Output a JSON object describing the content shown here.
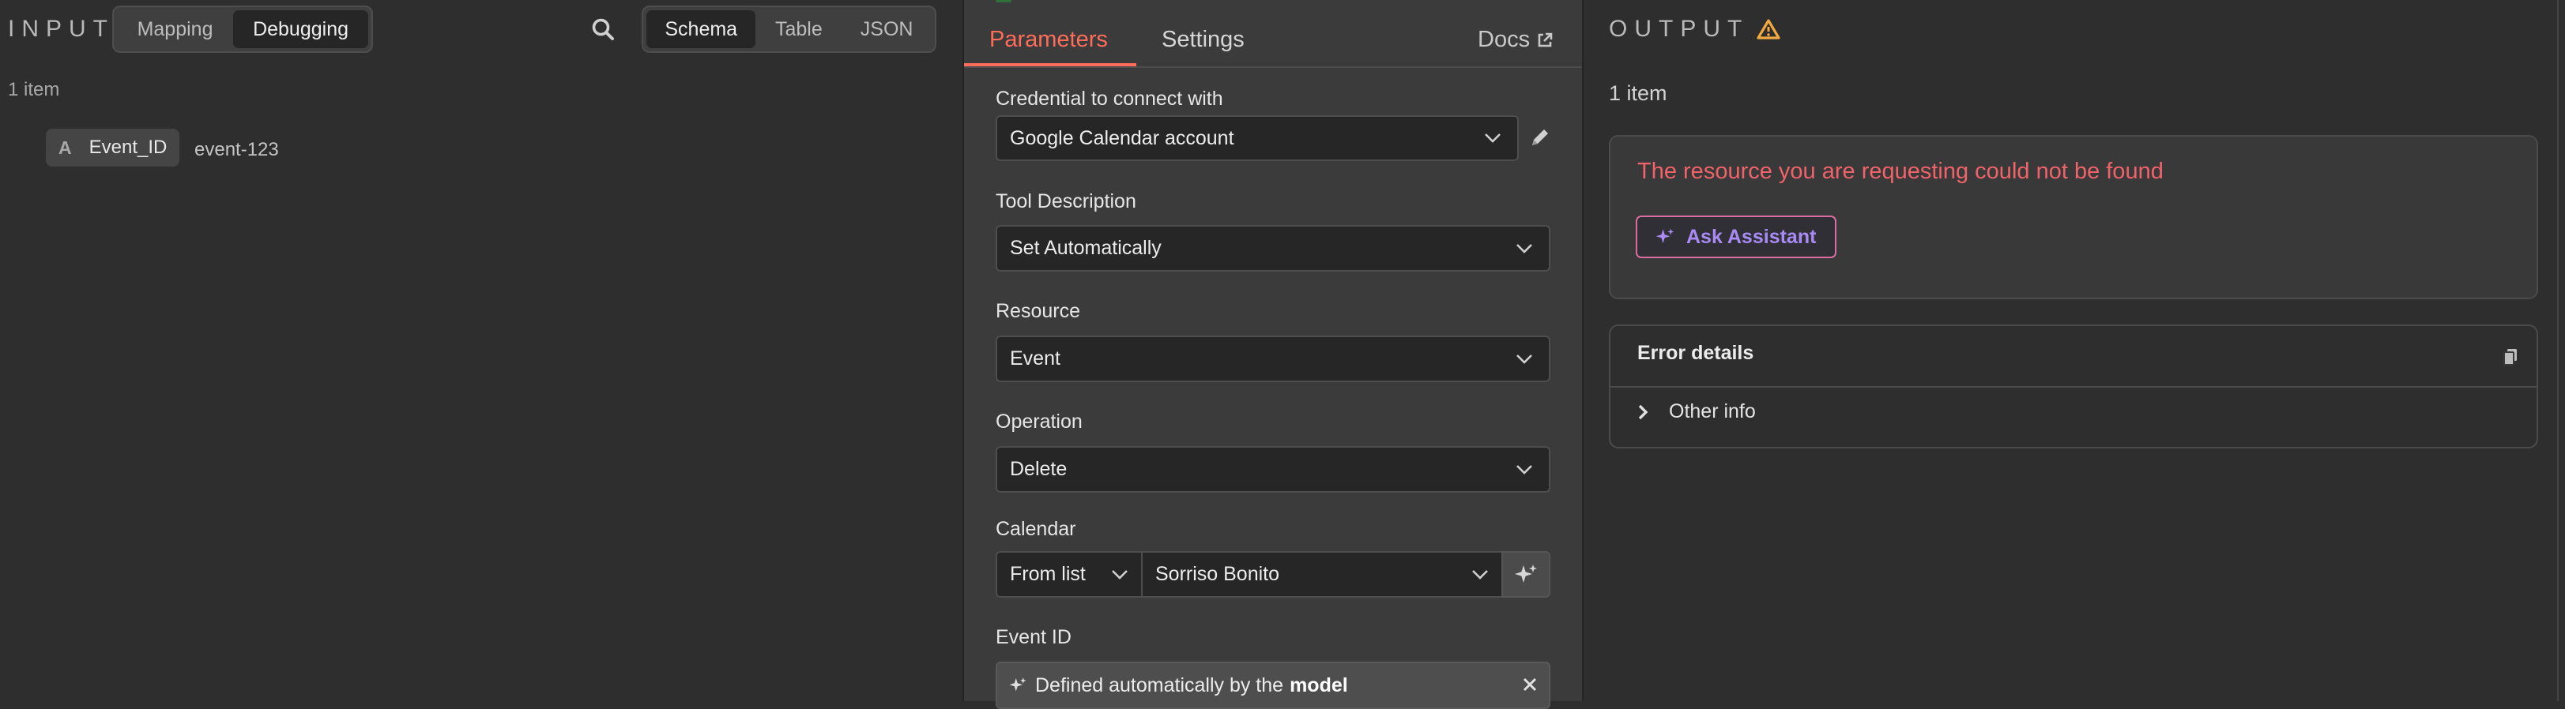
{
  "input": {
    "title": "INPUT",
    "mode_tabs": [
      "Mapping",
      "Debugging"
    ],
    "view_tabs": [
      "Schema",
      "Table",
      "JSON"
    ],
    "item_count": "1 item",
    "field": {
      "type_letter": "A",
      "name": "Event_ID",
      "value": "event-123"
    }
  },
  "params": {
    "tabs": [
      "Parameters",
      "Settings"
    ],
    "docs_label": "Docs",
    "credential_label": "Credential to connect with",
    "credential_value": "Google Calendar account",
    "tool_description_label": "Tool Description",
    "tool_description_value": "Set Automatically",
    "resource_label": "Resource",
    "resource_value": "Event",
    "operation_label": "Operation",
    "operation_value": "Delete",
    "calendar_label": "Calendar",
    "calendar_mode": "From list",
    "calendar_value": "Sorriso Bonito",
    "event_id_label": "Event ID",
    "event_id_prefix": "Defined automatically by the",
    "event_id_bold": "model"
  },
  "output": {
    "title": "OUTPUT",
    "item_count": "1 item",
    "error_message": "The resource you are requesting could not be found",
    "assistant_button": "Ask Assistant",
    "error_details_title": "Error details",
    "other_info_label": "Other info"
  },
  "colors": {
    "accent": "#ff6d5a",
    "error_text": "#f0636a",
    "warning": "#f4a940",
    "assistant_purple": "#a98bf5"
  }
}
